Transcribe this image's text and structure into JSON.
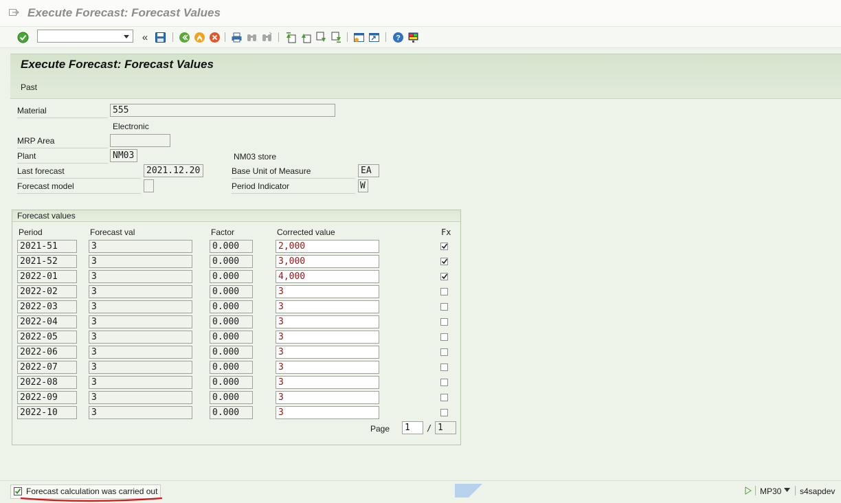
{
  "window_title": "Execute Forecast: Forecast Values",
  "toolbar": {
    "command_field_value": "",
    "icons": [
      "enter-icon",
      "command-dropdown",
      "back-chevron-icon",
      "save-icon",
      "back-icon",
      "exit-icon",
      "cancel-icon",
      "print-icon",
      "find-icon",
      "find-next-icon",
      "first-page-icon",
      "previous-page-icon",
      "next-page-icon",
      "last-page-icon",
      "new-session-icon",
      "shortcut-icon",
      "help-icon",
      "customize-layout-icon"
    ]
  },
  "header": {
    "title": "Execute Forecast: Forecast Values",
    "button_past": "Past"
  },
  "fields": {
    "material_label": "Material",
    "material_value": "555",
    "material_desc": "Electronic",
    "mrp_area_label": "MRP Area",
    "mrp_area_value": "",
    "plant_label": "Plant",
    "plant_value": "NM03",
    "plant_desc": "NM03 store",
    "last_forecast_label": "Last forecast",
    "last_forecast_value": "2021.12.20",
    "base_uom_label": "Base Unit of Measure",
    "base_uom_value": "EA",
    "forecast_model_label": "Forecast model",
    "forecast_model_value": "",
    "period_indicator_label": "Period Indicator",
    "period_indicator_value": "W"
  },
  "forecast": {
    "group_title": "Forecast values",
    "columns": {
      "period": "Period",
      "forecast_val": "Forecast val",
      "factor": "Factor",
      "corrected": "Corrected value",
      "fx": "Fx"
    },
    "rows": [
      {
        "period": "2021-51",
        "forecast_val": "3",
        "factor": "0.000",
        "corrected": "2,000",
        "fx": true
      },
      {
        "period": "2021-52",
        "forecast_val": "3",
        "factor": "0.000",
        "corrected": "3,000",
        "fx": true
      },
      {
        "period": "2022-01",
        "forecast_val": "3",
        "factor": "0.000",
        "corrected": "4,000",
        "fx": true
      },
      {
        "period": "2022-02",
        "forecast_val": "3",
        "factor": "0.000",
        "corrected": "3",
        "fx": false
      },
      {
        "period": "2022-03",
        "forecast_val": "3",
        "factor": "0.000",
        "corrected": "3",
        "fx": false
      },
      {
        "period": "2022-04",
        "forecast_val": "3",
        "factor": "0.000",
        "corrected": "3",
        "fx": false
      },
      {
        "period": "2022-05",
        "forecast_val": "3",
        "factor": "0.000",
        "corrected": "3",
        "fx": false
      },
      {
        "period": "2022-06",
        "forecast_val": "3",
        "factor": "0.000",
        "corrected": "3",
        "fx": false
      },
      {
        "period": "2022-07",
        "forecast_val": "3",
        "factor": "0.000",
        "corrected": "3",
        "fx": false
      },
      {
        "period": "2022-08",
        "forecast_val": "3",
        "factor": "0.000",
        "corrected": "3",
        "fx": false
      },
      {
        "period": "2022-09",
        "forecast_val": "3",
        "factor": "0.000",
        "corrected": "3",
        "fx": false
      },
      {
        "period": "2022-10",
        "forecast_val": "3",
        "factor": "0.000",
        "corrected": "3",
        "fx": false
      }
    ],
    "page_label": "Page",
    "page_current": "1",
    "page_separator": "/",
    "page_total": "1"
  },
  "status": {
    "message": "Forecast calculation was carried out",
    "transaction": "MP30",
    "system": "s4sapdev"
  },
  "colors": {
    "accent_red": "#d8151b",
    "header_green": "#d5e3cd",
    "corrected_text": "#8b1a1a"
  }
}
